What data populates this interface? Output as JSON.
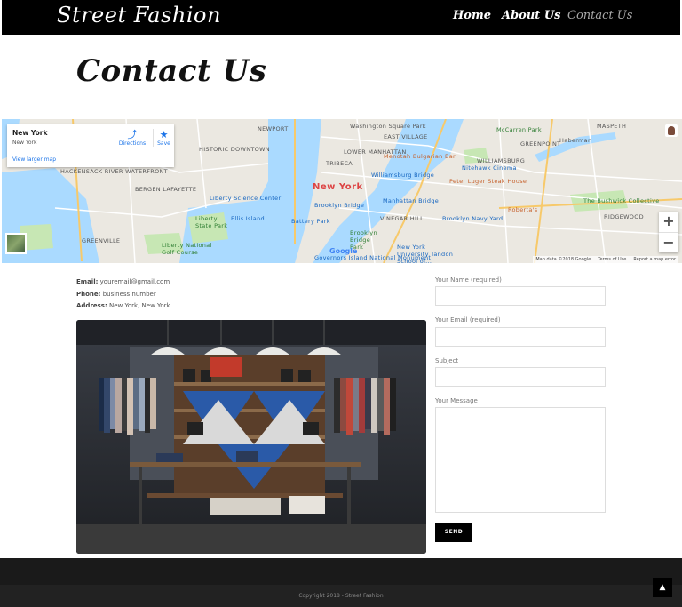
{
  "header": {
    "brand": "Street Fashion",
    "nav": {
      "home": "Home",
      "about": "About Us",
      "contact": "Contact Us"
    }
  },
  "page_title": "Contact Us",
  "map": {
    "card": {
      "place": "New York",
      "place_sub": "New York",
      "directions": "Directions",
      "save": "Save",
      "larger_map": "View larger map"
    },
    "labels": {
      "new_york": "New York",
      "newport": "NEWPORT",
      "historic_downtown": "HISTORIC DOWNTOWN",
      "hackensack": "HACKENSACK RIVER WATERFRONT",
      "bergen": "BERGEN LAFAYETTE",
      "greenville": "GREENVILLE",
      "liberty_science": "Liberty Science Center",
      "liberty_park": "Liberty State Park",
      "ellis": "Ellis Island",
      "liberty_national": "Liberty National Golf Course",
      "tribeca": "TRIBECA",
      "lower_manhattan": "LOWER MANHATTAN",
      "washington": "Washington Square Park",
      "east_village": "EAST VILLAGE",
      "williamsburg_bridge": "Williamsburg Bridge",
      "manhattan_bridge": "Manhattan Bridge",
      "brooklyn_bridge": "Brooklyn Bridge",
      "battery": "Battery Park",
      "brooklyn_park": "Brooklyn Bridge Park",
      "vinegar": "VINEGAR HILL",
      "navy_yard": "Brooklyn Navy Yard",
      "williamsburg": "WILLIAMSBURG",
      "greenpoint": "GREENPOINT",
      "mccarren": "McCarren Park",
      "nitehawk": "Nitehawk Cinema",
      "luger": "Peter Luger Steak House",
      "roberta": "Roberta's",
      "bushwick": "The Bushwick Collective",
      "ridgewood": "RIDGEWOOD",
      "maspeth": "MASPETH",
      "haberman": "Haberman",
      "menotah": "Menotah Bulgarian Bar",
      "nyu": "New York University Tandon School of...",
      "governors": "Governors Island National Monument"
    },
    "google": "Google",
    "footer": {
      "data": "Map data ©2018 Google",
      "terms": "Terms of Use",
      "report": "Report a map error"
    }
  },
  "contact_info": {
    "email_label": "Email:",
    "email": "youremail@gmail.com",
    "phone_label": "Phone:",
    "phone": "business number",
    "address_label": "Address:",
    "address": "New York, New York"
  },
  "form": {
    "name_label": "Your Name (required)",
    "email_label": "Your Email (required)",
    "subject_label": "Subject",
    "message_label": "Your Message",
    "send": "SEND"
  },
  "footer": {
    "copyright": "Copyright 2018 - Street Fashion"
  },
  "colors": {
    "header_bg": "#000000",
    "footer_bg": "#222222",
    "accent_link": "#1a73e8"
  }
}
